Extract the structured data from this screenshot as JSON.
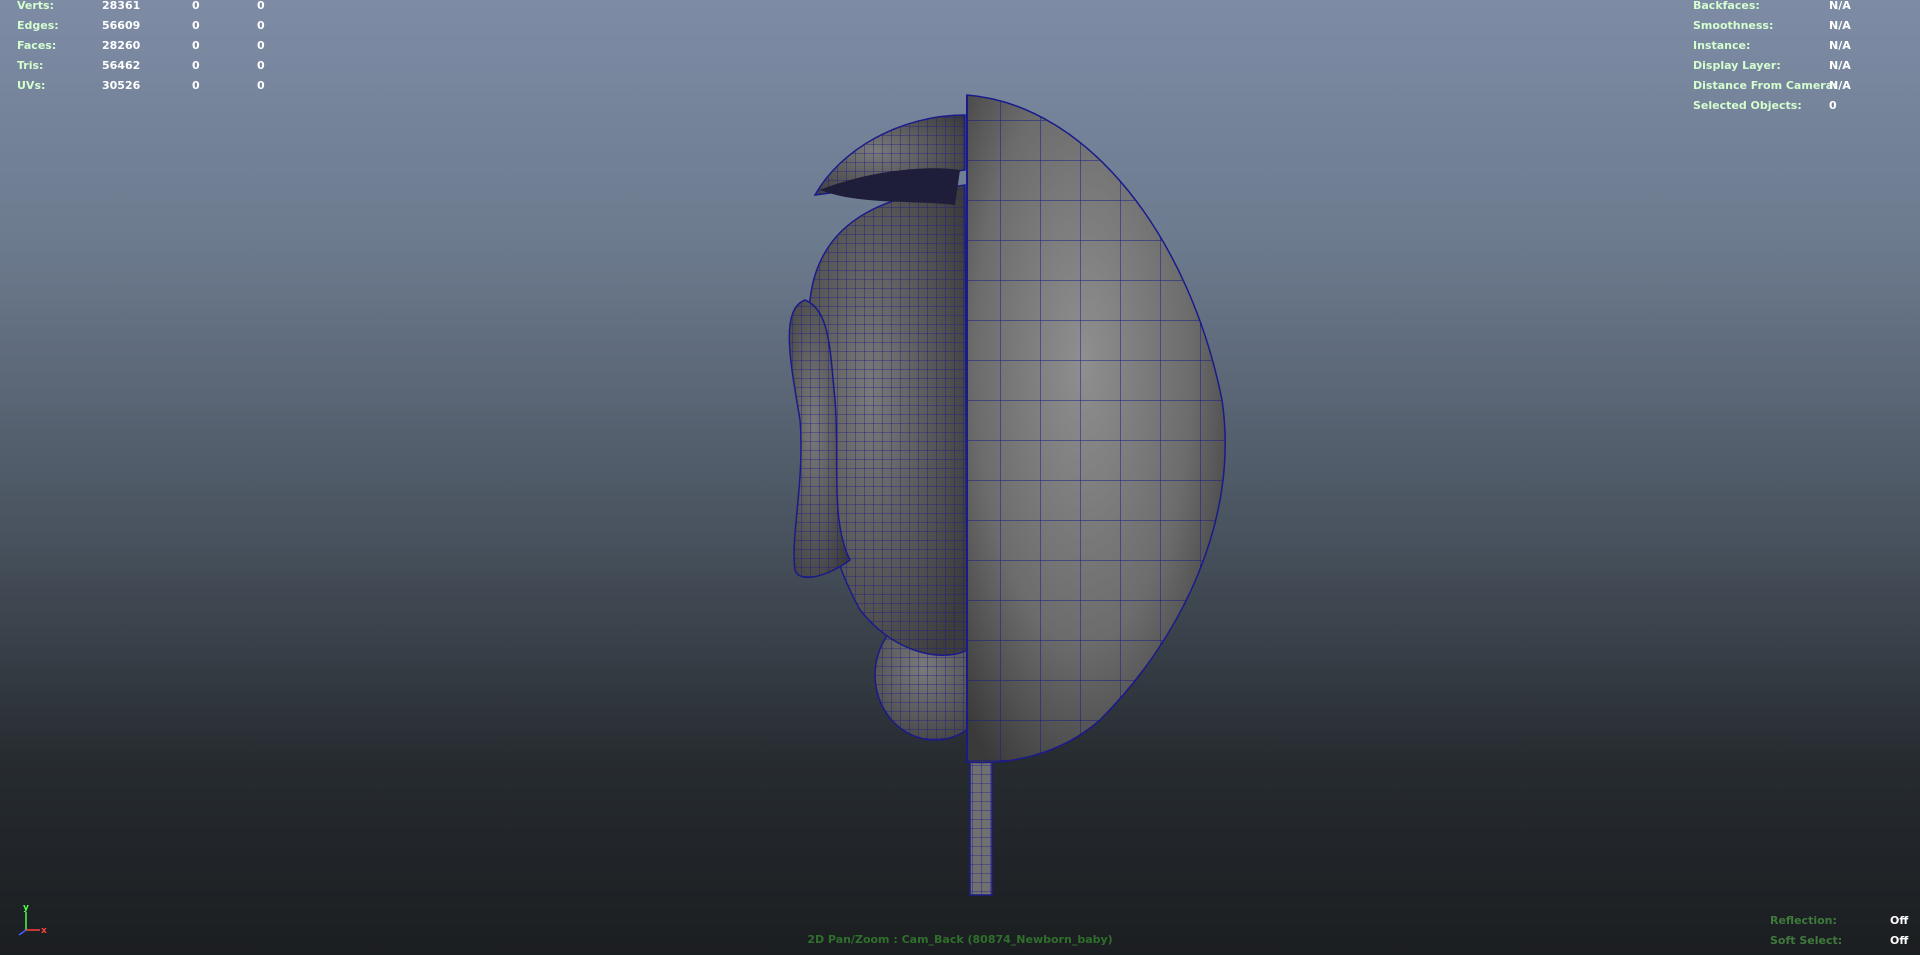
{
  "stats_left": [
    {
      "label": "Verts:",
      "values": [
        "28361",
        "0",
        "0"
      ]
    },
    {
      "label": "Edges:",
      "values": [
        "56609",
        "0",
        "0"
      ]
    },
    {
      "label": "Faces:",
      "values": [
        "28260",
        "0",
        "0"
      ]
    },
    {
      "label": "Tris:",
      "values": [
        "56462",
        "0",
        "0"
      ]
    },
    {
      "label": "UVs:",
      "values": [
        "30526",
        "0",
        "0"
      ]
    }
  ],
  "stats_right": [
    {
      "label": "Backfaces:",
      "value": "N/A"
    },
    {
      "label": "Smoothness:",
      "value": "N/A"
    },
    {
      "label": "Instance:",
      "value": "N/A"
    },
    {
      "label": "Display Layer:",
      "value": "N/A"
    },
    {
      "label": "Distance From Camera:",
      "value": "N/A"
    },
    {
      "label": "Selected Objects:",
      "value": "0"
    }
  ],
  "bottom_right": [
    {
      "label": "Reflection:",
      "value": "Off"
    },
    {
      "label": "Soft Select:",
      "value": "Off"
    }
  ],
  "camera_label": "2D Pan/Zoom : Cam_Back (80874_Newborn_baby)",
  "axis": {
    "y_label": "y",
    "x_label": "x"
  },
  "colors": {
    "hud_label": "#d6ffd0",
    "hud_value": "#ffffff",
    "wireframe": "#1a1a8a",
    "mesh_shade": "#7a7a7a",
    "camera_label": "#2f6f2c"
  },
  "icons": {
    "model": "wireframe-head-mesh",
    "gizmo": "axis-gizmo-icon"
  }
}
